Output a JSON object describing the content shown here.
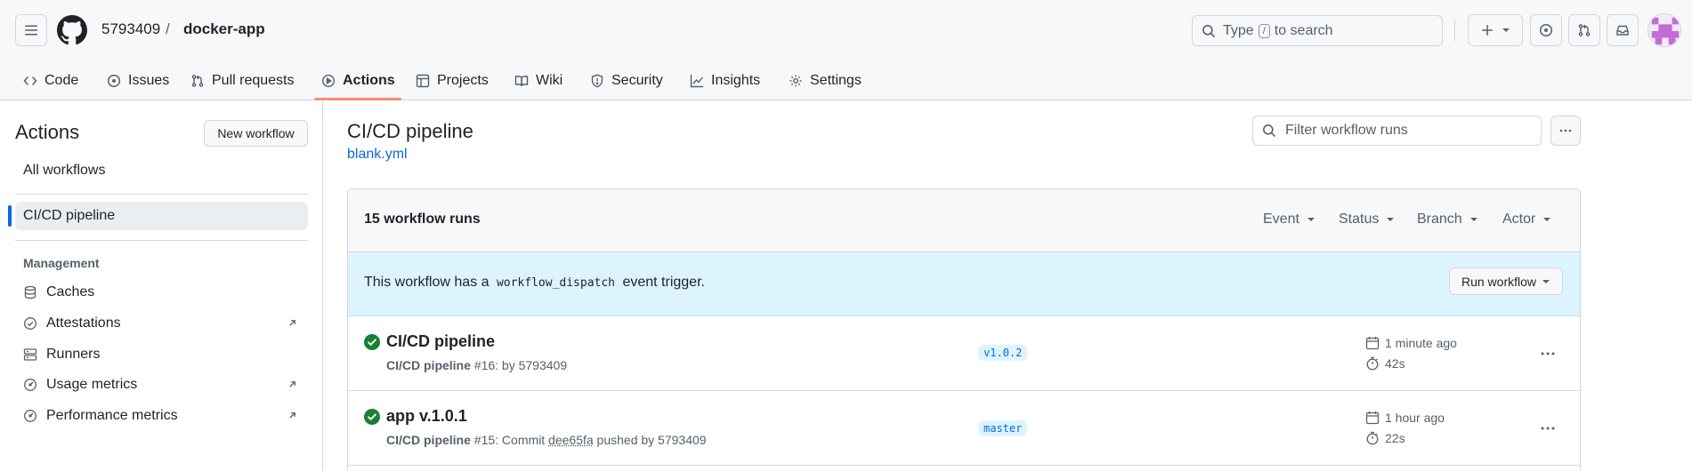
{
  "repo": {
    "owner": "5793409",
    "separator": "/",
    "name": "docker-app"
  },
  "search": {
    "prefix": "Type",
    "key": "/",
    "suffix": "to search"
  },
  "tabs": [
    {
      "label": "Code",
      "icon": "code-icon"
    },
    {
      "label": "Issues",
      "icon": "issue-opened-icon"
    },
    {
      "label": "Pull requests",
      "icon": "git-pull-request-icon"
    },
    {
      "label": "Actions",
      "icon": "play-icon",
      "active": true
    },
    {
      "label": "Projects",
      "icon": "table-icon"
    },
    {
      "label": "Wiki",
      "icon": "book-icon"
    },
    {
      "label": "Security",
      "icon": "shield-icon"
    },
    {
      "label": "Insights",
      "icon": "graph-icon"
    },
    {
      "label": "Settings",
      "icon": "gear-icon"
    }
  ],
  "sidebar": {
    "title": "Actions",
    "new_workflow": "New workflow",
    "all_workflows": "All workflows",
    "selected_workflow": "CI/CD pipeline",
    "management_heading": "Management",
    "management": [
      {
        "label": "Caches",
        "icon": "database-icon",
        "external": false
      },
      {
        "label": "Attestations",
        "icon": "verified-icon",
        "external": true
      },
      {
        "label": "Runners",
        "icon": "server-icon",
        "external": false
      },
      {
        "label": "Usage metrics",
        "icon": "meter-icon",
        "external": true
      },
      {
        "label": "Performance metrics",
        "icon": "meter-icon",
        "external": true
      }
    ]
  },
  "main": {
    "title": "CI/CD pipeline",
    "file": "blank.yml",
    "filter_placeholder": "Filter workflow runs",
    "runs_count": "15 workflow runs",
    "facets": [
      "Event",
      "Status",
      "Branch",
      "Actor"
    ],
    "banner": {
      "before": "This workflow has a",
      "code": "workflow_dispatch",
      "after": "event trigger."
    },
    "run_workflow": "Run workflow",
    "runs": [
      {
        "title": "CI/CD pipeline",
        "workflow": "CI/CD pipeline",
        "detail": "#16: by 5793409",
        "branch": "v1.0.2",
        "when": "1 minute ago",
        "duration": "42s"
      },
      {
        "title": "app v.1.0.1",
        "workflow": "CI/CD pipeline",
        "detail_pre": "#15: Commit",
        "commit": "dee65fa",
        "detail_post": "pushed by 5793409",
        "branch": "master",
        "when": "1 hour ago",
        "duration": "22s"
      }
    ]
  },
  "colors": {
    "accent": "#0969da",
    "success": "#1a7f37",
    "tab_underline": "#fd8c73",
    "banner_bg": "#ddf4ff"
  }
}
